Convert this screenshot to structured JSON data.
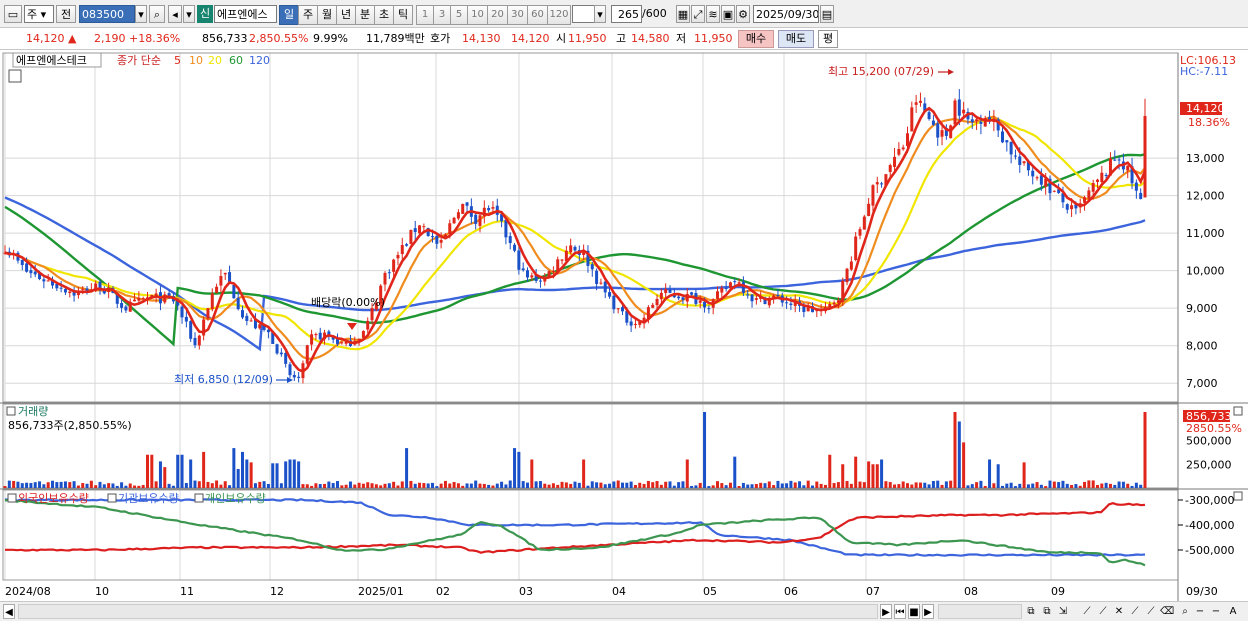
{
  "toolbar": {
    "market_select": "주",
    "prev_label": "전",
    "stock_code": "083500",
    "new_label": "신",
    "stock_name": "에프엔에스",
    "periods": [
      "일",
      "주",
      "월",
      "년",
      "분",
      "초",
      "틱"
    ],
    "active_period": "일",
    "intervals": [
      "1",
      "3",
      "5",
      "10",
      "20",
      "30",
      "60",
      "120"
    ],
    "count_value": "265",
    "count_max": "/600",
    "date_value": "2025/09/30"
  },
  "quote": {
    "price": "14,120 ▲",
    "change": "2,190 +18.36%",
    "volume": "856,733",
    "volume_ratio": "2,850.55%",
    "rotation": "9.99%",
    "amount": "11,789백만",
    "ask_label": "호가",
    "ask_value": "14,130",
    "bid_value": "14,120",
    "open_label": "시",
    "open_value": "11,950",
    "high_label": "고",
    "high_value": "14,580",
    "low_label": "저",
    "low_value": "11,950",
    "buy_label": "매수",
    "sell_label": "매도",
    "eval_label": "평"
  },
  "price_panel": {
    "name": "에프엔에스테크",
    "ma_label": "종가 단순",
    "ma_periods": [
      "5",
      "10",
      "20",
      "60",
      "120"
    ],
    "lc_label": "LC:106.13",
    "hc_label": "HC:-7.11",
    "high_annotation": "최고 15,200 (07/29)",
    "low_annotation": "최저 6,850 (12/09)",
    "dividend_annotation": "배당락(0.00%)",
    "last_price_tag": "14,120",
    "last_change_tag": "18.36%",
    "y_ticks": [
      "13,000",
      "12,000",
      "11,000",
      "10,000",
      "9,000",
      "8,000",
      "7,000"
    ]
  },
  "volume_panel": {
    "title": "거래량",
    "subtitle": "856,733주(2,850.55%)",
    "last_tag": "856,733",
    "last_ratio_tag": "2850.55%",
    "y_ticks": [
      "500,000",
      "250,000"
    ]
  },
  "holdings_panel": {
    "legend": [
      "외국인보유수량",
      "기관보유수량",
      "개인보유수량"
    ],
    "y_ticks": [
      "-300,000",
      "-400,000",
      "-500,000"
    ]
  },
  "x_axis": {
    "labels": [
      "2024/08",
      "10",
      "11",
      "12",
      "2025/01",
      "02",
      "03",
      "04",
      "05",
      "06",
      "07",
      "08",
      "09",
      "09/30"
    ]
  },
  "colors": {
    "up": "#e0261a",
    "down": "#1a50c8",
    "ma5": "#e0261a",
    "ma10": "#f08c1e",
    "ma20": "#f0e600",
    "ma60": "#1e9632",
    "ma120": "#3c64dc",
    "foreign": "#3c64dc",
    "institution": "#dc1e1e",
    "individual": "#3c9650"
  },
  "chart_data": [
    {
      "type": "candlestick",
      "title": "에프엔에스테크",
      "x_range": [
        "2024/08",
        "2025/09/30"
      ],
      "ylim": [
        6500,
        15800
      ],
      "series_ma": [
        "5",
        "10",
        "20",
        "60",
        "120"
      ],
      "annotations": [
        {
          "label": "최고 15,200 (07/29)",
          "value": 15200,
          "date": "2025/07/29"
        },
        {
          "label": "최저 6,850 (12/09)",
          "value": 6850,
          "date": "2024/12/09"
        }
      ],
      "last": {
        "open": 11950,
        "high": 14580,
        "low": 11950,
        "close": 14120
      }
    },
    {
      "type": "bar",
      "title": "거래량",
      "last_value": 856733,
      "ylim": [
        0,
        800000
      ]
    },
    {
      "type": "line",
      "series": [
        {
          "name": "외국인보유수량"
        },
        {
          "name": "기관보유수량"
        },
        {
          "name": "개인보유수량"
        }
      ],
      "ylim": [
        -620000,
        -260000
      ]
    }
  ]
}
